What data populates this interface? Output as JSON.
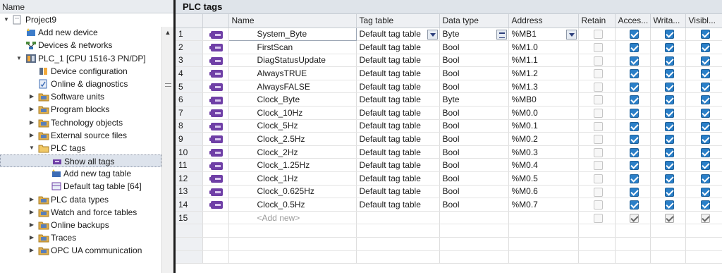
{
  "tree": {
    "header": "Name",
    "items": [
      {
        "label": "Project9",
        "level": 0,
        "arrow": "▼",
        "icon": "doc"
      },
      {
        "label": "Add new device",
        "level": 1,
        "arrow": "",
        "icon": "star-add"
      },
      {
        "label": "Devices & networks",
        "level": 1,
        "arrow": "",
        "icon": "network"
      },
      {
        "label": "PLC_1 [CPU 1516-3 PN/DP]",
        "level": 1,
        "arrow": "▼",
        "icon": "plc"
      },
      {
        "label": "Device configuration",
        "level": 2,
        "arrow": "",
        "icon": "config"
      },
      {
        "label": "Online & diagnostics",
        "level": 2,
        "arrow": "",
        "icon": "diag"
      },
      {
        "label": "Software units",
        "level": 2,
        "arrow": "▶",
        "icon": "folder"
      },
      {
        "label": "Program blocks",
        "level": 2,
        "arrow": "▶",
        "icon": "folder"
      },
      {
        "label": "Technology objects",
        "level": 2,
        "arrow": "▶",
        "icon": "folder"
      },
      {
        "label": "External source files",
        "level": 2,
        "arrow": "▶",
        "icon": "folder"
      },
      {
        "label": "PLC tags",
        "level": 2,
        "arrow": "▼",
        "icon": "folder-open"
      },
      {
        "label": "Show all tags",
        "level": 3,
        "arrow": "",
        "icon": "tags",
        "selected": true
      },
      {
        "label": "Add new tag table",
        "level": 3,
        "arrow": "",
        "icon": "tag-add"
      },
      {
        "label": "Default tag table [64]",
        "level": 3,
        "arrow": "",
        "icon": "tag-table"
      },
      {
        "label": "PLC data types",
        "level": 2,
        "arrow": "▶",
        "icon": "folder"
      },
      {
        "label": "Watch and force tables",
        "level": 2,
        "arrow": "▶",
        "icon": "folder"
      },
      {
        "label": "Online backups",
        "level": 2,
        "arrow": "▶",
        "icon": "folder"
      },
      {
        "label": "Traces",
        "level": 2,
        "arrow": "▶",
        "icon": "folder"
      },
      {
        "label": "OPC UA communication",
        "level": 2,
        "arrow": "▶",
        "icon": "folder"
      }
    ]
  },
  "editor": {
    "title": "PLC tags",
    "columns": [
      "",
      "",
      "Name",
      "Tag table",
      "Data type",
      "Address",
      "Retain",
      "Acces...",
      "Writa...",
      "Visibl..."
    ],
    "rows": [
      {
        "num": "1",
        "name": "System_Byte",
        "table": "Default tag table",
        "type": "Byte",
        "address": "%MB1"
      },
      {
        "num": "2",
        "name": "FirstScan",
        "table": "Default tag table",
        "type": "Bool",
        "address": "%M1.0"
      },
      {
        "num": "3",
        "name": "DiagStatusUpdate",
        "table": "Default tag table",
        "type": "Bool",
        "address": "%M1.1"
      },
      {
        "num": "4",
        "name": "AlwaysTRUE",
        "table": "Default tag table",
        "type": "Bool",
        "address": "%M1.2"
      },
      {
        "num": "5",
        "name": "AlwaysFALSE",
        "table": "Default tag table",
        "type": "Bool",
        "address": "%M1.3"
      },
      {
        "num": "6",
        "name": "Clock_Byte",
        "table": "Default tag table",
        "type": "Byte",
        "address": "%MB0"
      },
      {
        "num": "7",
        "name": "Clock_10Hz",
        "table": "Default tag table",
        "type": "Bool",
        "address": "%M0.0"
      },
      {
        "num": "8",
        "name": "Clock_5Hz",
        "table": "Default tag table",
        "type": "Bool",
        "address": "%M0.1"
      },
      {
        "num": "9",
        "name": "Clock_2.5Hz",
        "table": "Default tag table",
        "type": "Bool",
        "address": "%M0.2"
      },
      {
        "num": "10",
        "name": "Clock_2Hz",
        "table": "Default tag table",
        "type": "Bool",
        "address": "%M0.3"
      },
      {
        "num": "11",
        "name": "Clock_1.25Hz",
        "table": "Default tag table",
        "type": "Bool",
        "address": "%M0.4"
      },
      {
        "num": "12",
        "name": "Clock_1Hz",
        "table": "Default tag table",
        "type": "Bool",
        "address": "%M0.5"
      },
      {
        "num": "13",
        "name": "Clock_0.625Hz",
        "table": "Default tag table",
        "type": "Bool",
        "address": "%M0.6"
      },
      {
        "num": "14",
        "name": "Clock_0.5Hz",
        "table": "Default tag table",
        "type": "Bool",
        "address": "%M0.7"
      }
    ],
    "add_row": {
      "num": "15",
      "placeholder": "<Add new>"
    }
  }
}
